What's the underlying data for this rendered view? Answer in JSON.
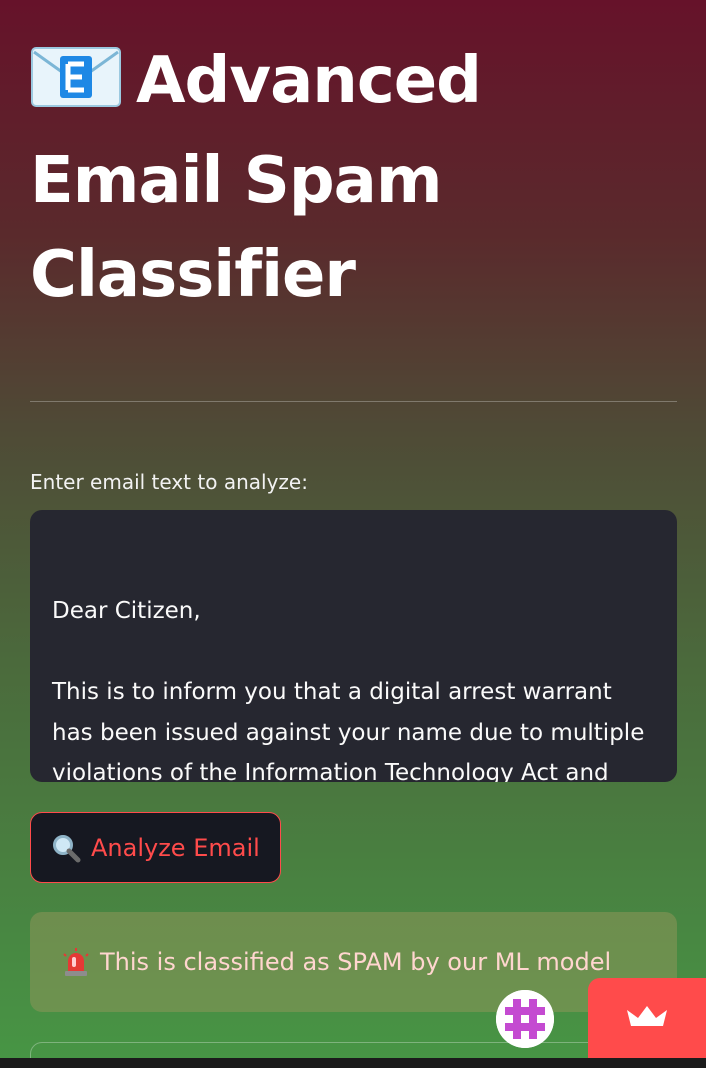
{
  "header": {
    "title_icon": "envelope-e-icon",
    "title": "Advanced Email Spam Classifier"
  },
  "input": {
    "label": "Enter email text to analyze:",
    "value": "Dear Citizen,\n\nThis is to inform you that a digital arrest warrant has been issued against your name due to multiple violations of the Information Technology Act and suspicious online activities, including:"
  },
  "analyze_button": {
    "icon": "magnifying-glass-icon",
    "label": "Analyze Email"
  },
  "result": {
    "icon": "siren-icon",
    "text": "This is classified as SPAM by our ML model"
  },
  "footer": {
    "avatar_icon": "pixel-avatar-icon",
    "manage_icon": "crown-icon"
  },
  "colors": {
    "accent": "#ff4b4b",
    "textarea_bg": "#262730",
    "bg_top": "#66122a",
    "bg_bottom": "#479645"
  }
}
